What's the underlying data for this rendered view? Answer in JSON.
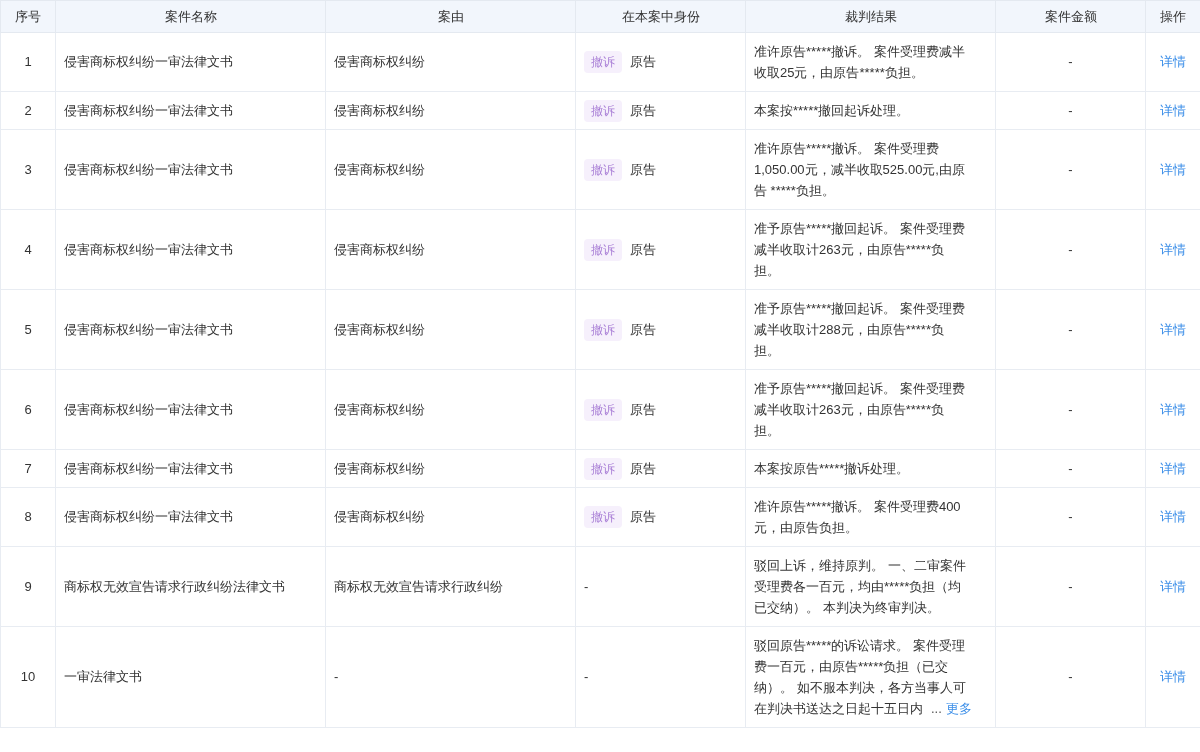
{
  "table": {
    "columns": [
      "序号",
      "案件名称",
      "案由",
      "在本案中身份",
      "裁判结果",
      "案件金额",
      "操作"
    ],
    "rows": [
      {
        "index": "1",
        "name": "侵害商标权纠纷一审法律文书",
        "cause": "侵害商标权纠纷",
        "tag": "撤诉",
        "role": "原告",
        "result": [
          "准许原告*****撤诉。 案件受理费减半",
          "收取25元，由原告*****负担。"
        ],
        "amount": "-",
        "action": "详情"
      },
      {
        "index": "2",
        "name": "侵害商标权纠纷一审法律文书",
        "cause": "侵害商标权纠纷",
        "tag": "撤诉",
        "role": "原告",
        "result": [
          "本案按*****撤回起诉处理。"
        ],
        "amount": "-",
        "action": "详情"
      },
      {
        "index": "3",
        "name": "侵害商标权纠纷一审法律文书",
        "cause": "侵害商标权纠纷",
        "tag": "撤诉",
        "role": "原告",
        "result": [
          "准许原告*****撤诉。 案件受理费",
          "1,050.00元，减半收取525.00元,由原",
          "告 *****负担。"
        ],
        "amount": "-",
        "action": "详情"
      },
      {
        "index": "4",
        "name": "侵害商标权纠纷一审法律文书",
        "cause": "侵害商标权纠纷",
        "tag": "撤诉",
        "role": "原告",
        "result": [
          "准予原告*****撤回起诉。 案件受理费",
          "减半收取计263元，由原告*****负",
          "担。"
        ],
        "amount": "-",
        "action": "详情"
      },
      {
        "index": "5",
        "name": "侵害商标权纠纷一审法律文书",
        "cause": "侵害商标权纠纷",
        "tag": "撤诉",
        "role": "原告",
        "result": [
          "准予原告*****撤回起诉。 案件受理费",
          "减半收取计288元，由原告*****负",
          "担。"
        ],
        "amount": "-",
        "action": "详情"
      },
      {
        "index": "6",
        "name": "侵害商标权纠纷一审法律文书",
        "cause": "侵害商标权纠纷",
        "tag": "撤诉",
        "role": "原告",
        "result": [
          "准予原告*****撤回起诉。 案件受理费",
          "减半收取计263元，由原告*****负",
          "担。"
        ],
        "amount": "-",
        "action": "详情"
      },
      {
        "index": "7",
        "name": "侵害商标权纠纷一审法律文书",
        "cause": "侵害商标权纠纷",
        "tag": "撤诉",
        "role": "原告",
        "result": [
          "本案按原告*****撤诉处理。"
        ],
        "amount": "-",
        "action": "详情"
      },
      {
        "index": "8",
        "name": "侵害商标权纠纷一审法律文书",
        "cause": "侵害商标权纠纷",
        "tag": "撤诉",
        "role": "原告",
        "result": [
          "准许原告*****撤诉。 案件受理费400",
          "元，由原告负担。"
        ],
        "amount": "-",
        "action": "详情"
      },
      {
        "index": "9",
        "name": "商标权无效宣告请求行政纠纷法律文书",
        "cause": "商标权无效宣告请求行政纠纷",
        "role": "-",
        "result": [
          "驳回上诉，维持原判。 一、二审案件",
          "受理费各一百元，均由*****负担（均",
          "已交纳）。 本判决为终审判决。"
        ],
        "amount": "-",
        "action": "详情"
      },
      {
        "index": "10",
        "name": "一审法律文书",
        "cause": "-",
        "role": "-",
        "result": [
          "驳回原告*****的诉讼请求。 案件受理",
          "费一百元，由原告*****负担（已交",
          "纳）。 如不服本判决，各方当事人可",
          "在判决书送达之日起十五日内"
        ],
        "ellipsis": "...",
        "more": "更多",
        "amount": "-",
        "action": "详情"
      }
    ]
  }
}
